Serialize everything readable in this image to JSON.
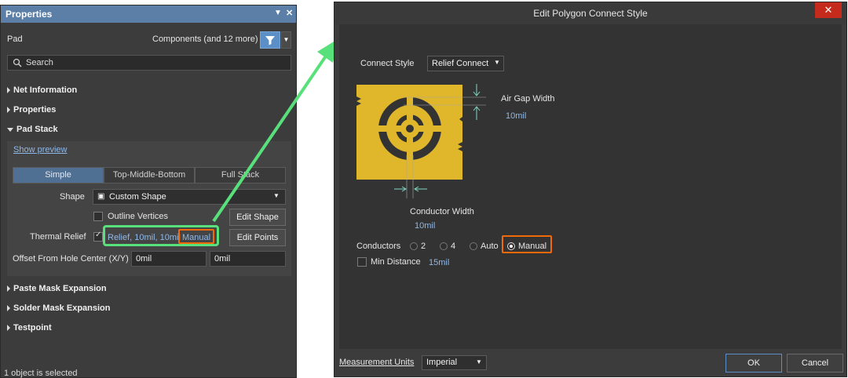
{
  "properties": {
    "title": "Properties",
    "object_type": "Pad",
    "filter_text": "Components (and 12 more)",
    "search_placeholder": "Search",
    "sections": {
      "net_information": "Net Information",
      "properties": "Properties",
      "pad_stack": "Pad Stack",
      "paste_mask": "Paste Mask Expansion",
      "solder_mask": "Solder Mask Expansion",
      "testpoint": "Testpoint"
    },
    "show_preview": "Show preview",
    "tabs": [
      "Simple",
      "Top-Middle-Bottom",
      "Full Stack"
    ],
    "shape_label": "Shape",
    "shape_value": "Custom Shape",
    "outline_vertices": "Outline Vertices",
    "edit_shape": "Edit Shape",
    "thermal_relief_label": "Thermal Relief",
    "thermal_relief_value": "Relief, 10mil, 10mil",
    "thermal_relief_mode": "Manual",
    "edit_points": "Edit Points",
    "offset_label": "Offset From Hole Center (X/Y)",
    "offset_x": "0mil",
    "offset_y": "0mil",
    "status": "1 object is selected"
  },
  "dialog": {
    "title": "Edit Polygon Connect Style",
    "close": "✕",
    "connect_style_label": "Connect Style",
    "connect_style_value": "Relief Connect",
    "air_gap_label": "Air Gap Width",
    "air_gap_value": "10mil",
    "conductor_width_label": "Conductor Width",
    "conductor_width_value": "10mil",
    "conductors_label": "Conductors",
    "conductor_options": [
      "2",
      "4",
      "Auto",
      "Manual"
    ],
    "conductor_selected": "Manual",
    "min_distance_label": "Min Distance",
    "min_distance_value": "15mil",
    "measurement_units_label": "Measurement Units",
    "measurement_units_value": "Imperial",
    "ok": "OK",
    "cancel": "Cancel"
  },
  "colors": {
    "accent": "#5b7fa6",
    "copper": "#e0b62a",
    "highlight_orange": "#f06a0a",
    "highlight_green": "#58e07a"
  }
}
